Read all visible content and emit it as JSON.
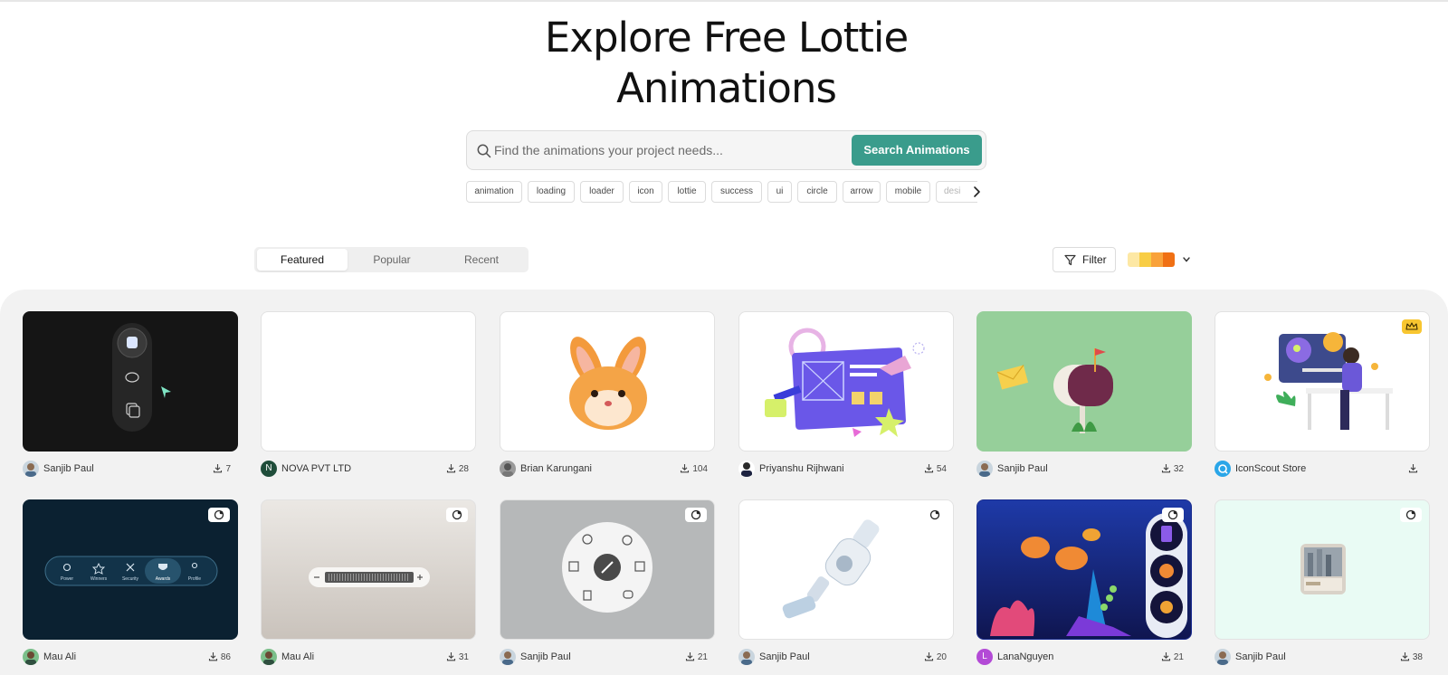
{
  "hero": {
    "title_line1": "Explore Free Lottie",
    "title_line2": "Animations"
  },
  "search": {
    "placeholder": "Find the animations your project needs...",
    "button_label": "Search Animations"
  },
  "tags": [
    "animation",
    "loading",
    "loader",
    "icon",
    "lottie",
    "success",
    "ui",
    "circle",
    "arrow",
    "mobile",
    "desi"
  ],
  "tabs": [
    "Featured",
    "Popular",
    "Recent"
  ],
  "active_tab": "Featured",
  "filter_label": "Filter",
  "palette_colors": [
    "#fde8a4",
    "#f8cd45",
    "#f9a23a",
    "#f07014"
  ],
  "colors": {
    "accent": "#3a9c8c",
    "gallery_bg": "#f2f2f2",
    "crown": "#f8c630"
  },
  "cards": [
    {
      "author": "Sanjib Paul",
      "downloads": "7",
      "bg": "#151515",
      "art": "dark-sidebar-menu",
      "badge": "none"
    },
    {
      "author": "NOVA PVT LTD",
      "downloads": "28",
      "bg": "#ffffff",
      "art": "blank",
      "badge": "none",
      "avatar_letter": "N",
      "avatar_color": "#1f4d3a"
    },
    {
      "author": "Brian Karungani",
      "downloads": "104",
      "bg": "#ffffff",
      "art": "rabbit-face",
      "badge": "none"
    },
    {
      "author": "Priyanshu Rijhwani",
      "downloads": "54",
      "bg": "#ffffff",
      "art": "design-board",
      "badge": "none"
    },
    {
      "author": "Sanjib Paul",
      "downloads": "32",
      "bg": "#96cf9a",
      "art": "mailbox",
      "badge": "none"
    },
    {
      "author": "IconScout Store",
      "downloads": "",
      "bg": "#ffffff",
      "art": "robot-crypto",
      "badge": "crown"
    },
    {
      "author": "Mau Ali",
      "downloads": "86",
      "bg": "#0b2131",
      "art": "nav-bar",
      "badge": "edit",
      "nav_items": [
        "Power",
        "Winners",
        "Security",
        "Awards",
        "Profile"
      ]
    },
    {
      "author": "Mau Ali",
      "downloads": "31",
      "bg": "#dcd8d4",
      "art": "stepper-slider",
      "badge": "edit"
    },
    {
      "author": "Sanjib Paul",
      "downloads": "21",
      "bg": "#b6b8b9",
      "art": "radial-menu",
      "badge": "edit"
    },
    {
      "author": "Sanjib Paul",
      "downloads": "20",
      "bg": "#ffffff",
      "art": "vacuum",
      "badge": "edit"
    },
    {
      "author": "LanaNguyen",
      "downloads": "21",
      "bg": "#1a2c8f",
      "art": "fish-scene",
      "badge": "edit",
      "avatar_letter": "L",
      "avatar_color": "#b34ad6"
    },
    {
      "author": "Sanjib Paul",
      "downloads": "38",
      "bg": "#e9fbf4",
      "art": "city-card",
      "badge": "edit"
    }
  ]
}
